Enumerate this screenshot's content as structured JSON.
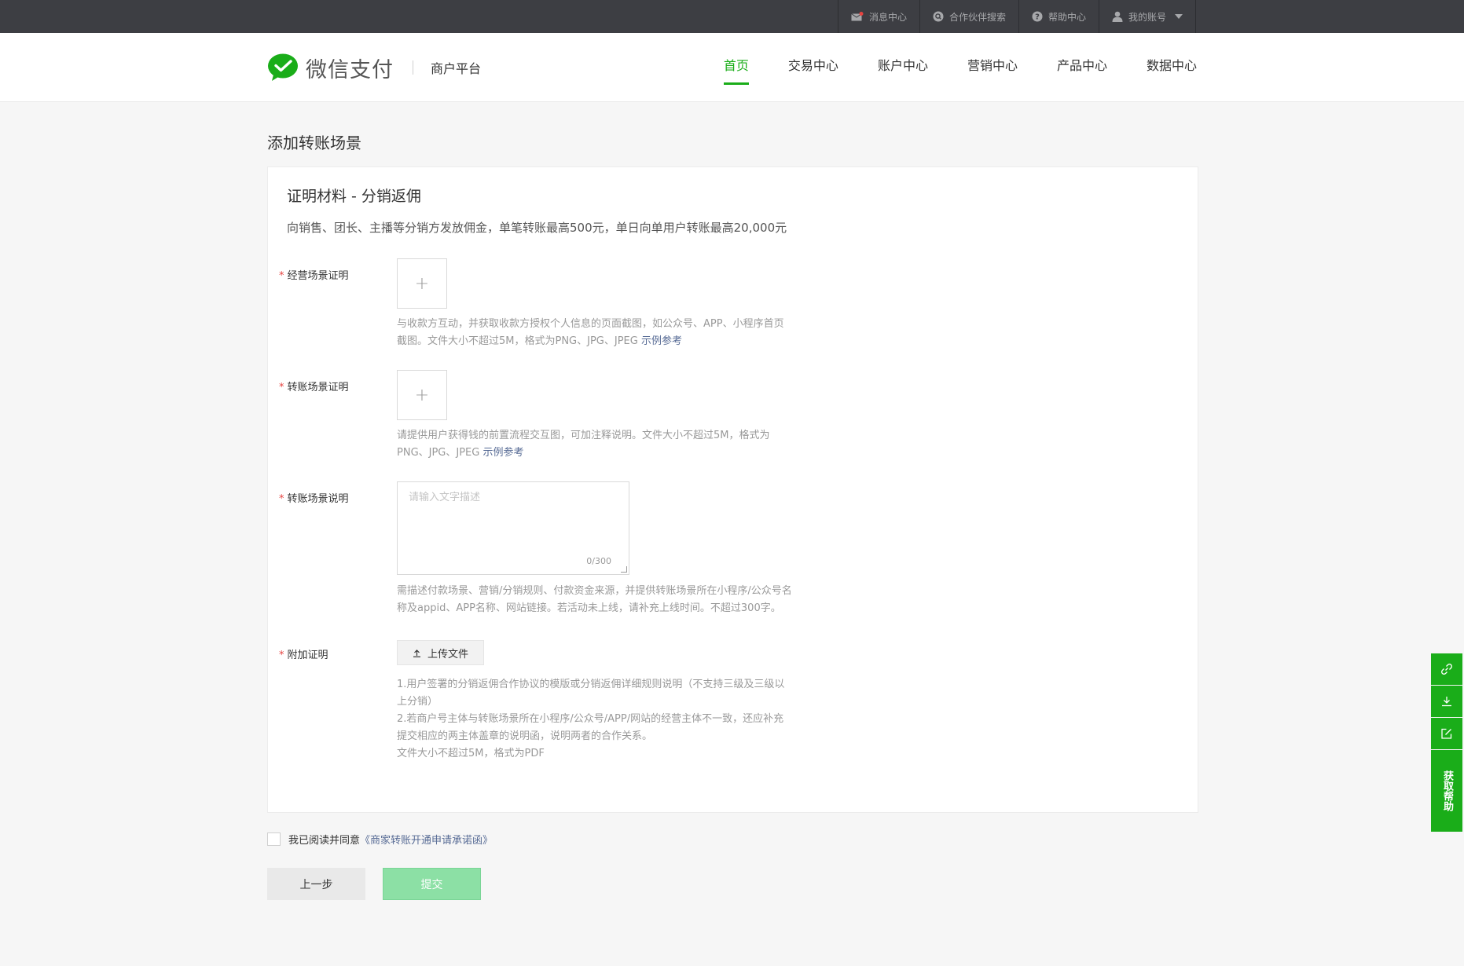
{
  "topbar": {
    "items": [
      {
        "label": "消息中心",
        "icon": "mail-icon"
      },
      {
        "label": "合作伙伴搜索",
        "icon": "search-icon"
      },
      {
        "label": "帮助中心",
        "icon": "help-icon"
      },
      {
        "label": "我的账号",
        "icon": "user-icon"
      }
    ]
  },
  "header": {
    "logo_text": "微信支付",
    "platform": "商户平台",
    "nav": [
      {
        "label": "首页",
        "active": true
      },
      {
        "label": "交易中心"
      },
      {
        "label": "账户中心"
      },
      {
        "label": "营销中心"
      },
      {
        "label": "产品中心"
      },
      {
        "label": "数据中心"
      }
    ]
  },
  "page": {
    "title": "添加转账场景",
    "card_title": "证明材料 - 分销返佣",
    "card_desc": "向销售、团长、主播等分销方发放佣金，单笔转账最高500元，单日向单用户转账最高20,000元"
  },
  "fields": {
    "scene_proof": {
      "label": "经营场景证明",
      "hint_1": "与收款方互动，并获取收款方授权个人信息的页面截图，如公众号、APP、小程序首页",
      "hint_2": "截图。文件大小不超过5M，格式为PNG、JPG、JPEG",
      "example": "示例参考"
    },
    "transfer_proof": {
      "label": "转账场景证明",
      "hint_1": "请提供用户获得钱的前置流程交互图，可加注释说明。文件大小不超过5M，格式为",
      "hint_2": "PNG、JPG、JPEG",
      "example": "示例参考"
    },
    "transfer_desc": {
      "label": "转账场景说明",
      "placeholder": "请输入文字描述",
      "value": "",
      "counter": "0/300",
      "hint_1": "需描述付款场景、营销/分销规则、付款资金来源，并提供转账场景所在小程序/公众号名",
      "hint_2": "称及appid、APP名称、网站链接。若活动未上线，请补充上线时间。不超过300字。"
    },
    "extra_proof": {
      "label": "附加证明",
      "button": "上传文件",
      "hint_1": "1.用户签署的分销返佣合作协议的模版或分销返佣详细规则说明（不支持三级及三级以",
      "hint_2": "上分销）",
      "hint_3": "2.若商户号主体与转账场景所在小程序/公众号/APP/网站的经营主体不一致，还应补充",
      "hint_4": "提交相应的两主体盖章的说明函，说明两者的合作关系。",
      "hint_5": "文件大小不超过5M，格式为PDF"
    }
  },
  "agreement": {
    "text": "我已阅读并同意",
    "link": "《商家转账开通申请承诺函》",
    "checked": false
  },
  "actions": {
    "prev": "上一步",
    "submit": "提交"
  },
  "sidebar": {
    "items": [
      "link-icon",
      "download-icon",
      "edit-icon"
    ],
    "help": "获取帮助"
  },
  "colors": {
    "brand_green": "#1aad19",
    "topbar_bg": "#3d3e43",
    "link_blue": "#576b95",
    "required_red": "#e64340",
    "submit_disabled": "#8ce0a5"
  }
}
